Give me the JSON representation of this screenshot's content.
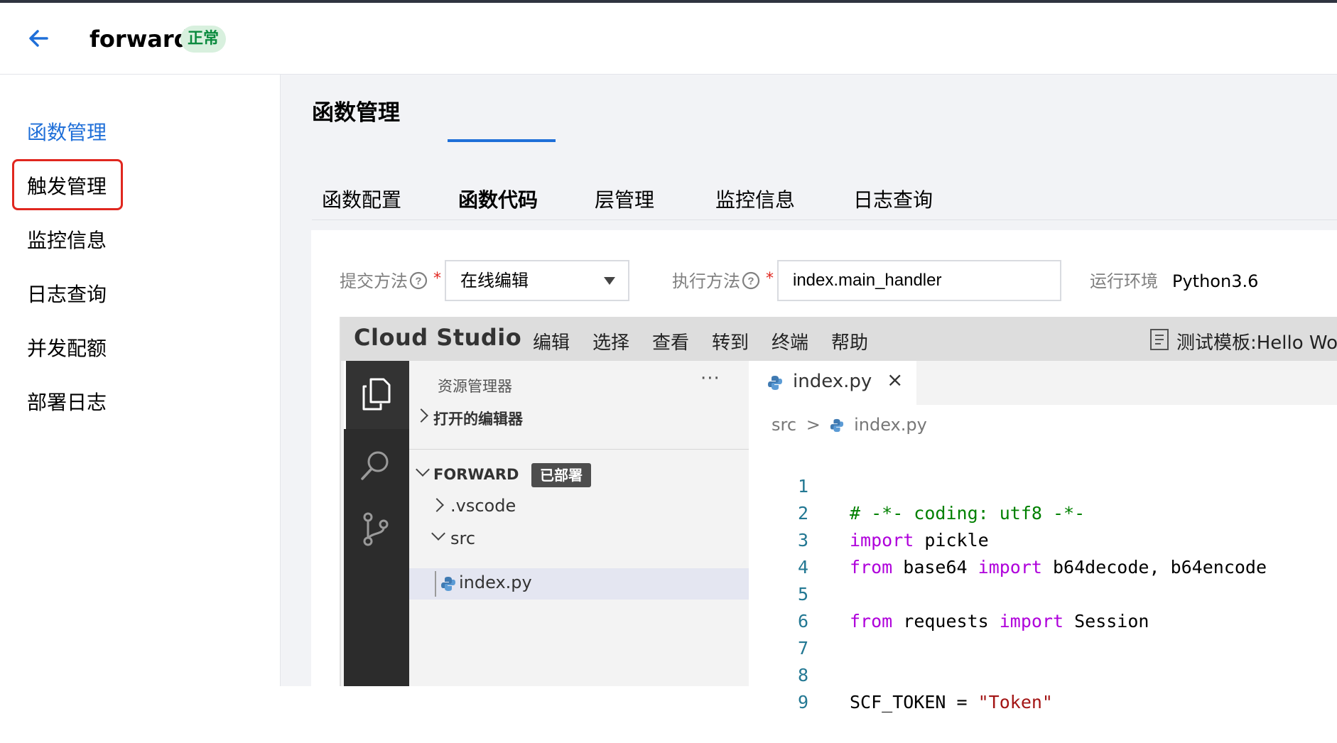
{
  "header": {
    "title": "forward",
    "status": "正常"
  },
  "sidebar": {
    "items": [
      {
        "label": "函数管理",
        "active": true
      },
      {
        "label": "触发管理",
        "active": false
      },
      {
        "label": "监控信息",
        "active": false
      },
      {
        "label": "日志查询",
        "active": false
      },
      {
        "label": "并发配额",
        "active": false
      },
      {
        "label": "部署日志",
        "active": false
      }
    ]
  },
  "main": {
    "title": "函数管理",
    "tabs": [
      {
        "label": "函数配置"
      },
      {
        "label": "函数代码",
        "active": true
      },
      {
        "label": "层管理"
      },
      {
        "label": "监控信息"
      },
      {
        "label": "日志查询"
      }
    ]
  },
  "form": {
    "submit_label": "提交方法",
    "submit_value": "在线编辑",
    "handler_label": "执行方法",
    "handler_value": "index.main_handler",
    "runtime_label": "运行环境",
    "runtime_value": "Python3.6",
    "required_mark": "*"
  },
  "studio": {
    "brand": "Cloud Studio",
    "menu": [
      "编辑",
      "选择",
      "查看",
      "转到",
      "终端",
      "帮助"
    ],
    "template": "测试模板:Hello World",
    "explorer": {
      "title": "资源管理器",
      "more": "···",
      "open_editors": "打开的编辑器",
      "project": "FORWARD",
      "deployed": "已部署",
      "tree": [
        ".vscode",
        "src",
        "index.py"
      ]
    },
    "editor": {
      "tab": "index.py",
      "close": "×",
      "crumb_folder": "src",
      "crumb_sep": ">",
      "crumb_file": "index.py",
      "lines": [
        "1",
        "2",
        "3",
        "4",
        "5",
        "6",
        "7",
        "8",
        "9"
      ]
    }
  },
  "colors": {
    "accent": "#1f6fd8",
    "status_bg": "#d8f0de",
    "status_text": "#0a8a3e",
    "highlight": "#e0271f"
  }
}
